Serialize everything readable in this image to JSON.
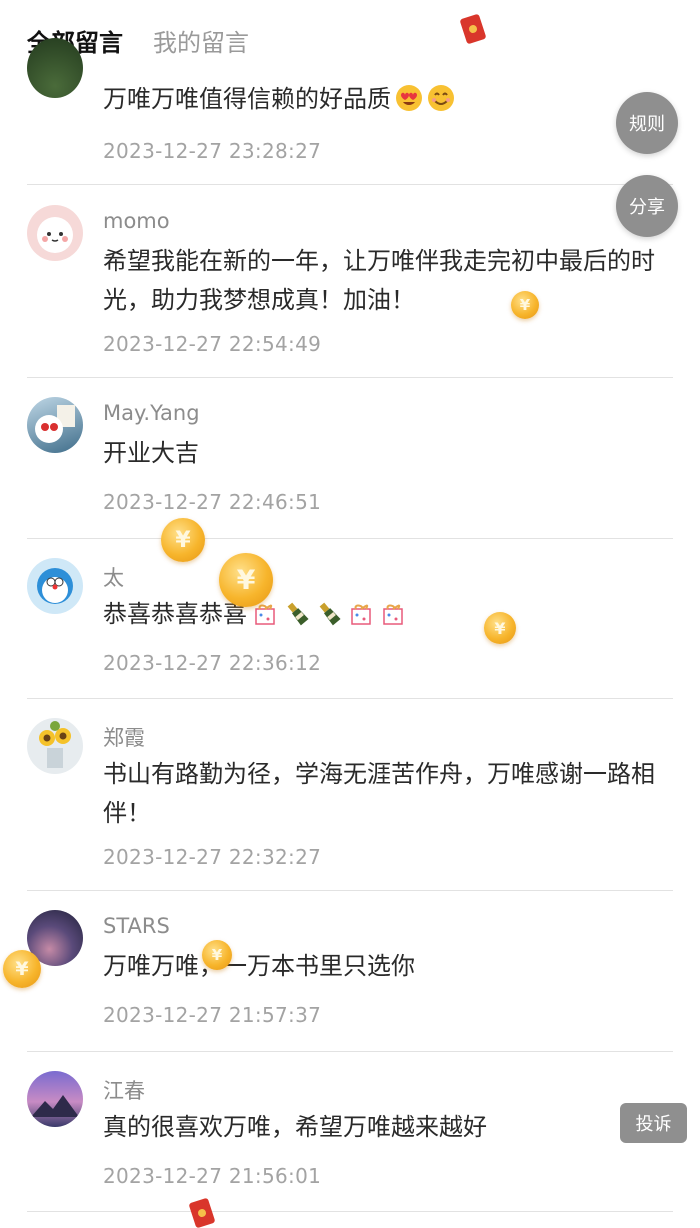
{
  "tabs": {
    "all": "全部留言",
    "mine": "我的留言"
  },
  "floating": {
    "rules": "规则",
    "share": "分享",
    "report": "投诉"
  },
  "coin_symbol": "¥",
  "comments": [
    {
      "name": "",
      "text": "万唯万唯值得信赖的好品质",
      "time": "2023-12-27 23:28:27",
      "emojis": [
        "heart-eyes-emoji-icon",
        "smile-emoji-icon"
      ]
    },
    {
      "name": "momo",
      "text": "希望我能在新的一年，让万唯伴我走完初中最后的时光，助力我梦想成真！加油！",
      "time": "2023-12-27 22:54:49"
    },
    {
      "name": "May.Yang",
      "text": "开业大吉",
      "time": "2023-12-27 22:46:51"
    },
    {
      "name": "太",
      "text": "恭喜恭喜恭喜",
      "time": "2023-12-27 22:36:12",
      "emojis": [
        "gift-emoji-icon",
        "champagne-emoji-icon",
        "champagne-emoji-icon",
        "gift-emoji-icon",
        "gift-emoji-icon"
      ]
    },
    {
      "name": "郑霞",
      "text": "书山有路勤为径，学海无涯苦作舟，万唯感谢一路相伴！",
      "time": "2023-12-27 22:32:27"
    },
    {
      "name": "STARS",
      "text": "万唯万唯，一万本书里只选你",
      "time": "2023-12-27 21:57:37"
    },
    {
      "name": "江春",
      "text": "真的很喜欢万唯，希望万唯越来越好",
      "time": "2023-12-27 21:56:01"
    }
  ],
  "colors": {
    "accent_coin": "#f7b52c",
    "floating_button": "#8f8f8f",
    "red_packet": "#d9362b"
  }
}
